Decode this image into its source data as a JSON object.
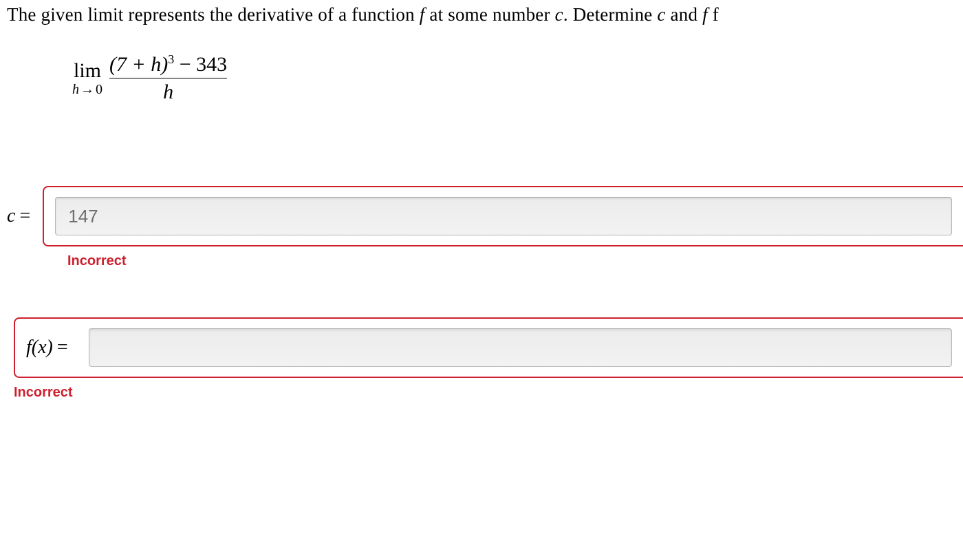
{
  "prompt": {
    "pre": "The given limit represents the derivative of a function ",
    "f1": "f",
    "mid1": " at some number ",
    "c1": "c",
    "mid2": ". Determine ",
    "c2": "c",
    "mid3": " and ",
    "f2": "f",
    "mid4": " f"
  },
  "limit": {
    "lim": "lim",
    "sub_h": "h",
    "sub_arrow": "→",
    "sub_zero": "0",
    "numerator": "(7 + h)",
    "num_exp": "3",
    "num_tail": " − 343",
    "denominator": "h"
  },
  "answers": {
    "c": {
      "label_var": "c",
      "label_eq": "=",
      "value": "147",
      "feedback": "Incorrect"
    },
    "fx": {
      "label_var": "f(x)",
      "label_eq": "=",
      "value": "",
      "feedback": "Incorrect"
    }
  }
}
